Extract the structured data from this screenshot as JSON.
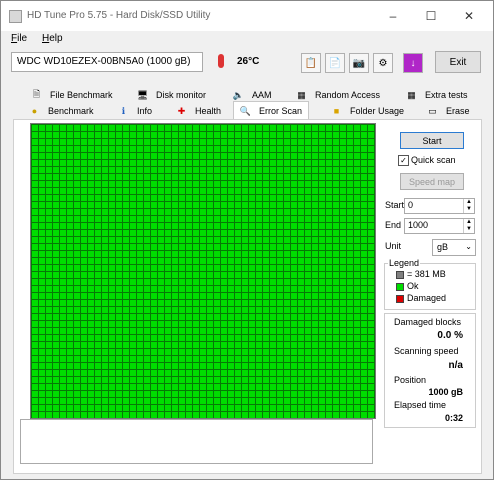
{
  "window": {
    "title": "HD Tune Pro 5.75 - Hard Disk/SSD Utility"
  },
  "menu": [
    {
      "first": "F",
      "rest": "ile"
    },
    {
      "first": "H",
      "rest": "elp"
    }
  ],
  "toolbar": {
    "drive": "WDC WD10EZEX-00BN5A0 (1000 gB)",
    "temperature": "26°C",
    "exit_label": "Exit"
  },
  "tabs_top": [
    {
      "label": "File Benchmark",
      "icon": "document-icon"
    },
    {
      "label": "Disk monitor",
      "icon": "monitor-icon"
    },
    {
      "label": "AAM",
      "icon": "speaker-icon"
    },
    {
      "label": "Random Access",
      "icon": "random-access-icon"
    },
    {
      "label": "Extra tests",
      "icon": "extra-tests-icon"
    }
  ],
  "tabs_bottom": [
    {
      "label": "Benchmark",
      "icon": "benchmark-icon"
    },
    {
      "label": "Info",
      "icon": "info-icon"
    },
    {
      "label": "Health",
      "icon": "health-cross-icon"
    },
    {
      "label": "Error Scan",
      "icon": "magnifier-icon",
      "active": true
    },
    {
      "label": "Folder Usage",
      "icon": "folder-icon"
    },
    {
      "label": "Erase",
      "icon": "erase-icon"
    }
  ],
  "controls": {
    "start_label": "Start",
    "quick_scan_label": "Quick scan",
    "quick_scan_checked": true,
    "speed_map_label": "Speed map",
    "start_field_label": "Start",
    "start_value": "0",
    "end_field_label": "End",
    "end_value": "1000",
    "unit_label": "Unit",
    "unit_value": "gB"
  },
  "legend": {
    "title": "Legend",
    "block_size": "= 381 MB",
    "ok": "Ok",
    "damaged": "Damaged",
    "colors": {
      "block": "#808080",
      "ok": "#00dd00",
      "damaged": "#dd0000"
    }
  },
  "stats": {
    "damaged_blocks_label": "Damaged blocks",
    "damaged_blocks_value": "0.0 %",
    "scanning_speed_label": "Scanning speed",
    "scanning_speed_value": "n/a",
    "position_label": "Position",
    "position_value": "1000 gB",
    "elapsed_label": "Elapsed time",
    "elapsed_value": "0:32"
  },
  "scan_grid": {
    "ok_color": "#00dd00",
    "line_color": "#067a06"
  }
}
